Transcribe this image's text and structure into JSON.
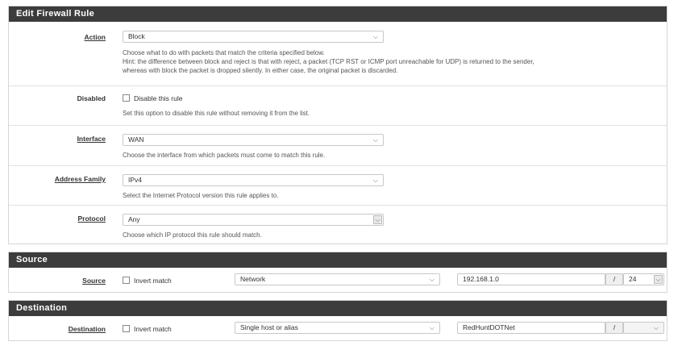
{
  "rule": {
    "title": "Edit Firewall Rule",
    "action": {
      "label": "Action",
      "value": "Block",
      "help1": "Choose what to do with packets that match the criteria specified below.",
      "help2": "Hint: the difference between block and reject is that with reject, a packet (TCP RST or ICMP port unreachable for UDP) is returned to the sender,",
      "help3": "whereas with block the packet is dropped silently. In either case, the original packet is discarded."
    },
    "disabled": {
      "label": "Disabled",
      "checkbox_label": "Disable this rule",
      "checked": false,
      "help": "Set this option to disable this rule without removing it from the list."
    },
    "interface": {
      "label": "Interface",
      "value": "WAN",
      "help": "Choose the interface from which packets must come to match this rule."
    },
    "address_family": {
      "label": "Address Family",
      "value": "IPv4",
      "help": "Select the Internet Protocol version this rule applies to."
    },
    "protocol": {
      "label": "Protocol",
      "value": "Any",
      "help": "Choose which IP protocol this rule should match."
    }
  },
  "source": {
    "title": "Source",
    "label": "Source",
    "invert_label": "Invert match",
    "invert_checked": false,
    "type_value": "Network",
    "address": "192.168.1.0",
    "slash": "/",
    "mask": "24"
  },
  "destination": {
    "title": "Destination",
    "label": "Destination",
    "invert_label": "Invert match",
    "invert_checked": false,
    "type_value": "Single host or alias",
    "address": "RedHuntDOTNet",
    "slash": "/",
    "mask": ""
  },
  "icons": {
    "chevron": "⌵"
  }
}
